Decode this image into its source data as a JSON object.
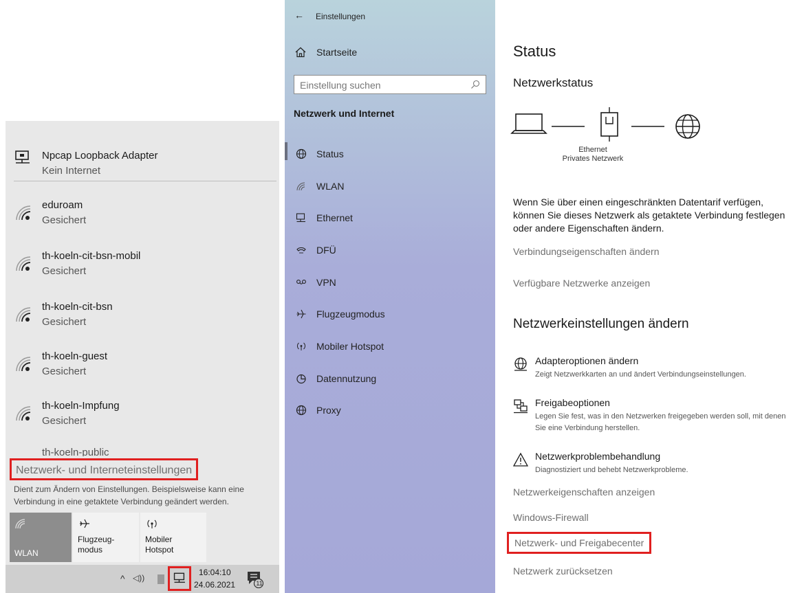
{
  "flyout": {
    "adapter": {
      "name": "Npcap Loopback Adapter",
      "status": "Kein Internet"
    },
    "networks": [
      {
        "name": "eduroam",
        "status": "Gesichert"
      },
      {
        "name": "th-koeln-cit-bsn-mobil",
        "status": "Gesichert"
      },
      {
        "name": "th-koeln-cit-bsn",
        "status": "Gesichert"
      },
      {
        "name": "th-koeln-guest",
        "status": "Gesichert"
      },
      {
        "name": "th-koeln-Impfung",
        "status": "Gesichert"
      }
    ],
    "partial_network": "th-koeln-public",
    "settings_link": "Netzwerk- und Interneteinstellungen",
    "settings_description": "Dient zum Ändern von Einstellungen. Beispielsweise kann eine Verbindung in eine getaktete Verbindung geändert werden.",
    "quick_actions": [
      {
        "label": "WLAN",
        "icon": "wifi-icon",
        "active": true
      },
      {
        "label": "Flugzeug-\nmodus",
        "icon": "airplane-icon",
        "active": false
      },
      {
        "label": "Mobiler\nHotspot",
        "icon": "hotspot-icon",
        "active": false
      }
    ]
  },
  "taskbar": {
    "time": "16:04:10",
    "date": "24.06.2021",
    "notification_count": "11",
    "chevron": "^",
    "volume": "◁))"
  },
  "nav": {
    "back": "←",
    "window_title": "Einstellungen",
    "home": "Startseite",
    "search_placeholder": "Einstellung suchen",
    "section_title": "Netzwerk und Internet",
    "items": [
      {
        "label": "Status",
        "icon": "status-globe-icon"
      },
      {
        "label": "WLAN",
        "icon": "wifi-icon"
      },
      {
        "label": "Ethernet",
        "icon": "ethernet-icon"
      },
      {
        "label": "DFÜ",
        "icon": "dialup-icon"
      },
      {
        "label": "VPN",
        "icon": "vpn-icon"
      },
      {
        "label": "Flugzeugmodus",
        "icon": "airplane-icon"
      },
      {
        "label": "Mobiler Hotspot",
        "icon": "hotspot-icon"
      },
      {
        "label": "Datennutzung",
        "icon": "data-usage-icon"
      },
      {
        "label": "Proxy",
        "icon": "proxy-globe-icon"
      }
    ]
  },
  "main": {
    "title": "Status",
    "network_status_heading": "Netzwerkstatus",
    "connection_name": "Ethernet",
    "connection_profile": "Privates Netzwerk",
    "metered_text": "Wenn Sie über einen eingeschränkten Datentarif verfügen, können Sie dieses Netzwerk als getaktete Verbindung festlegen oder andere Eigenschaften ändern.",
    "link_connection_properties": "Verbindungseigenschaften ändern",
    "link_available_networks": "Verfügbare Netzwerke anzeigen",
    "change_heading": "Netzwerkeinstellungen ändern",
    "options": [
      {
        "title": "Adapteroptionen ändern",
        "description": "Zeigt Netzwerkkarten an und ändert Verbindungseinstellungen."
      },
      {
        "title": "Freigabeoptionen",
        "description": "Legen Sie fest, was in den Netzwerken freigegeben werden soll, mit denen Sie eine Verbindung herstellen."
      },
      {
        "title": "Netzwerkproblembehandlung",
        "description": "Diagnostiziert und behebt Netzwerkprobleme."
      }
    ],
    "link_network_properties": "Netzwerkeigenschaften anzeigen",
    "link_firewall": "Windows-Firewall",
    "link_sharing_center": "Netzwerk- und Freigabecenter",
    "link_reset": "Netzwerk zurücksetzen"
  },
  "colors": {
    "highlight_red": "#e02020",
    "nav_top": "#b9d3dc",
    "nav_bottom": "#a5a8d8",
    "flyout_bg": "#e8e8e8",
    "link_gray": "#6f6f6f"
  }
}
